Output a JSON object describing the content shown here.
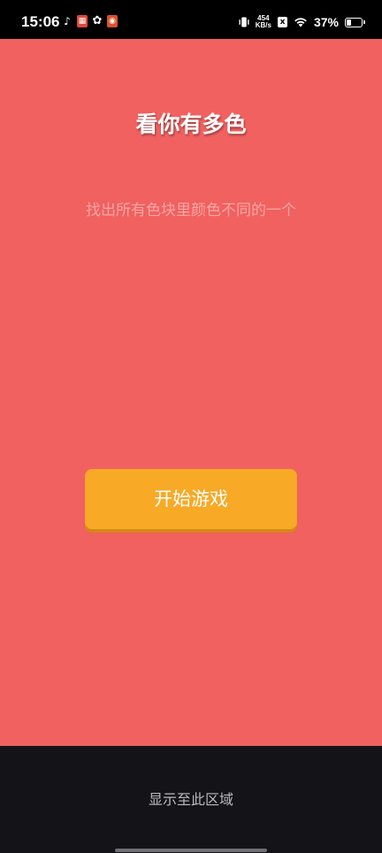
{
  "status_bar": {
    "time": "15:06",
    "net_speed_value": "454",
    "net_speed_unit": "KB/s",
    "sim_label": "x",
    "battery_percent": "37%"
  },
  "game": {
    "title": "看你有多色",
    "subtitle": "找出所有色块里颜色不同的一个",
    "start_button_label": "开始游戏",
    "background_color": "#f06160",
    "button_color": "#f8a926"
  },
  "bottom": {
    "label": "显示至此区域"
  }
}
